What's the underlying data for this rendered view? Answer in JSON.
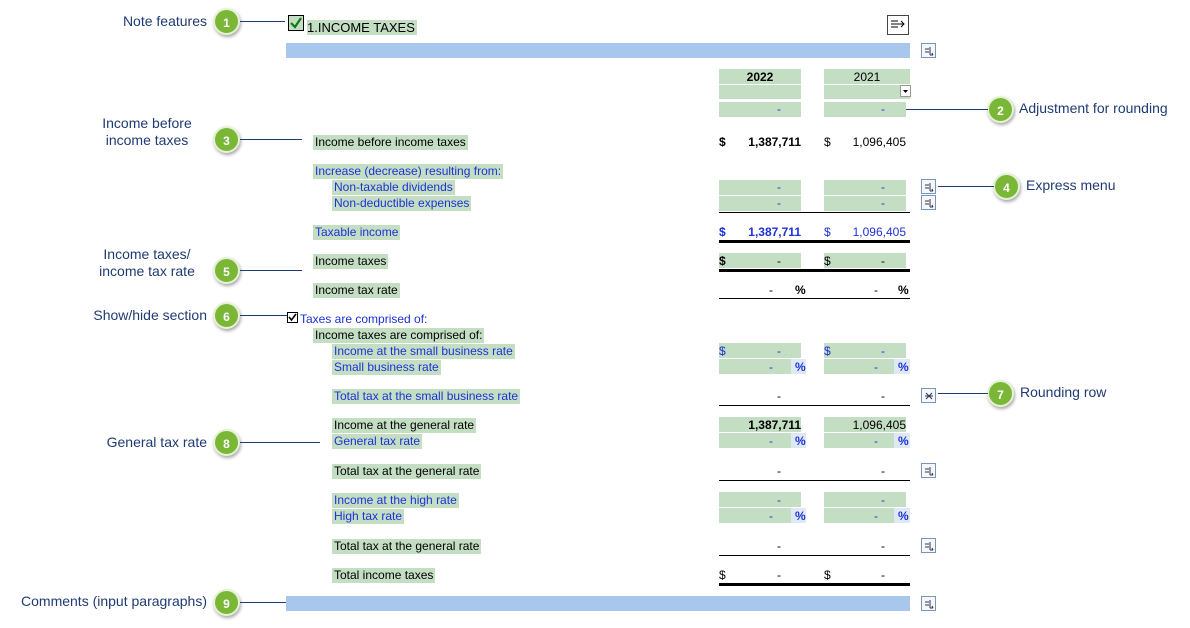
{
  "callouts": [
    {
      "n": "1",
      "label": "Note features"
    },
    {
      "n": "2",
      "label": "Adjustment for rounding"
    },
    {
      "n": "3",
      "label": "Income before income taxes"
    },
    {
      "n": "4",
      "label": "Express menu"
    },
    {
      "n": "5",
      "label": "Income taxes/ income tax rate"
    },
    {
      "n": "6",
      "label": "Show/hide section"
    },
    {
      "n": "7",
      "label": "Rounding row"
    },
    {
      "n": "8",
      "label": "General tax rate"
    },
    {
      "n": "9",
      "label": "Comments (input paragraphs)"
    }
  ],
  "header": {
    "title": "1.INCOME TAXES"
  },
  "years": {
    "current": "2022",
    "prior": "2021"
  },
  "rows": {
    "rounding": {
      "cur": "-",
      "pri": "-"
    },
    "income_before": {
      "label": "Income before income taxes",
      "cur_sym": "$",
      "cur": "1,387,711",
      "pri_sym": "$",
      "pri": "1,096,405"
    },
    "increase_heading": {
      "label": "Increase (decrease) resulting from:"
    },
    "nontaxable": {
      "label": "Non-taxable dividends",
      "cur": "-",
      "pri": "-"
    },
    "nondeductible": {
      "label": "Non-deductible expenses",
      "cur": "-",
      "pri": "-"
    },
    "taxable_income": {
      "label": "Taxable income",
      "cur_sym": "$",
      "cur": "1,387,711",
      "pri_sym": "$",
      "pri": "1,096,405"
    },
    "income_taxes": {
      "label": "Income taxes",
      "cur_sym": "$",
      "cur": "-",
      "pri_sym": "$",
      "pri": "-"
    },
    "income_tax_rate": {
      "label": "Income tax rate",
      "cur": "-",
      "pri": "-",
      "pct": "%"
    },
    "section_toggle": {
      "label": "Taxes are comprised of:"
    },
    "comprised_heading": {
      "label": "Income taxes are comprised of:"
    },
    "small_income": {
      "label": "Income at the small business rate",
      "cur_sym": "$",
      "cur": "-",
      "pri_sym": "$",
      "pri": "-"
    },
    "small_rate": {
      "label": "Small business rate",
      "cur": "-",
      "pri": "-",
      "pct": "%"
    },
    "small_total": {
      "label": "Total tax at the small business rate",
      "cur": "-",
      "pri": "-"
    },
    "general_income": {
      "label": "Income at the general rate",
      "cur": "1,387,711",
      "pri": "1,096,405"
    },
    "general_rate": {
      "label": "General tax rate",
      "cur": "-",
      "pri": "-",
      "pct": "%"
    },
    "general_total": {
      "label": "Total tax at the general rate",
      "cur": "-",
      "pri": "-"
    },
    "high_income": {
      "label": "Income at the high rate",
      "cur": "-",
      "pri": "-"
    },
    "high_rate": {
      "label": "High tax rate",
      "cur": "-",
      "pri": "-",
      "pct": "%"
    },
    "high_total": {
      "label": "Total tax at the general rate",
      "cur": "-",
      "pri": "-"
    },
    "total_taxes": {
      "label": "Total income taxes",
      "cur_sym": "$",
      "cur": "-",
      "pri_sym": "$",
      "pri": "-"
    }
  }
}
